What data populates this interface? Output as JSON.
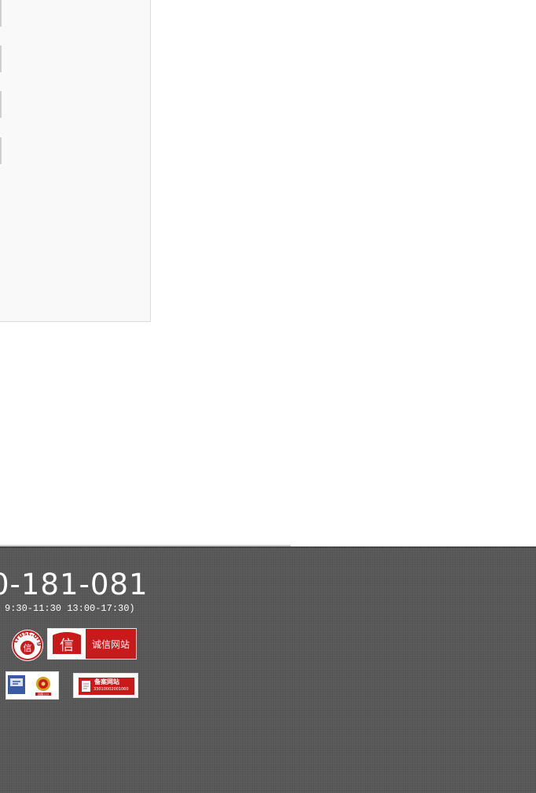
{
  "footer": {
    "phone": "0-181-081",
    "hours": "9:30-11:30 13:00-17:30)",
    "badges": {
      "trust_seal_text": "trust.org.cn",
      "trust_seal_char": "信",
      "integrity_char": "信",
      "integrity_label": "诚信网站",
      "police_caption": "网络110",
      "record_label": "备案网站",
      "record_number": "33010002001060"
    }
  },
  "colors": {
    "footer_bg": "#555555",
    "badge_red": "#c81a1a",
    "sidebar_bg": "#f9f9f9"
  }
}
